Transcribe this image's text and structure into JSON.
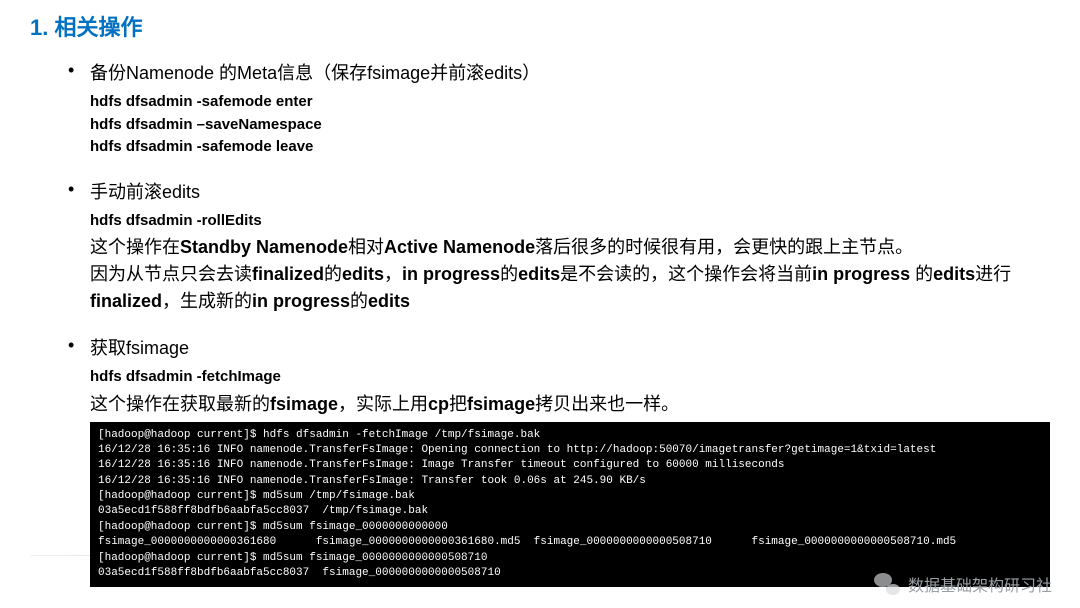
{
  "title": "1. 相关操作",
  "items": [
    {
      "heading": "备份Namenode 的Meta信息（保存fsimage并前滚edits）",
      "commands": [
        "hdfs dfsadmin -safemode enter",
        "hdfs dfsadmin –saveNamespace",
        "hdfs dfsadmin -safemode leave"
      ]
    },
    {
      "heading": "手动前滚edits",
      "commands": [
        "hdfs dfsadmin -rollEdits"
      ],
      "explain_html": "这个操作在<b>Standby Namenode</b>相对<b>Active Namenode</b>落后很多的时候很有用，会更快的跟上主节点。\n因为从节点只会去读<b>finalized</b>的<b>edits</b>，<b>in progress</b>的<b>edits</b>是不会读的，这个操作会将当前<b>in progress</b> 的<b>edits</b>进行<b>finalized</b>，生成新的<b>in progress</b>的<b>edits</b>"
    },
    {
      "heading": "获取fsimage",
      "commands": [
        "hdfs dfsadmin -fetchImage"
      ],
      "explain_html": "这个操作在获取最新的<b>fsimage</b>，实际上用<b>cp</b>把<b>fsimage</b>拷贝出来也一样。"
    }
  ],
  "terminal_lines": [
    "[hadoop@hadoop current]$ hdfs dfsadmin -fetchImage /tmp/fsimage.bak",
    "16/12/28 16:35:16 INFO namenode.TransferFsImage: Opening connection to http://hadoop:50070/imagetransfer?getimage=1&txid=latest",
    "16/12/28 16:35:16 INFO namenode.TransferFsImage: Image Transfer timeout configured to 60000 milliseconds",
    "16/12/28 16:35:16 INFO namenode.TransferFsImage: Transfer took 0.06s at 245.90 KB/s",
    "[hadoop@hadoop current]$ md5sum /tmp/fsimage.bak",
    "03a5ecd1f588ff8bdfb6aabfa5cc8037  /tmp/fsimage.bak",
    "[hadoop@hadoop current]$ md5sum fsimage_0000000000000",
    "fsimage_0000000000000361680      fsimage_0000000000000361680.md5  fsimage_0000000000000508710      fsimage_0000000000000508710.md5",
    "[hadoop@hadoop current]$ md5sum fsimage_0000000000000508710",
    "03a5ecd1f588ff8bdfb6aabfa5cc8037  fsimage_0000000000000508710"
  ],
  "footer": {
    "brand": "数据基础架构研习社"
  }
}
